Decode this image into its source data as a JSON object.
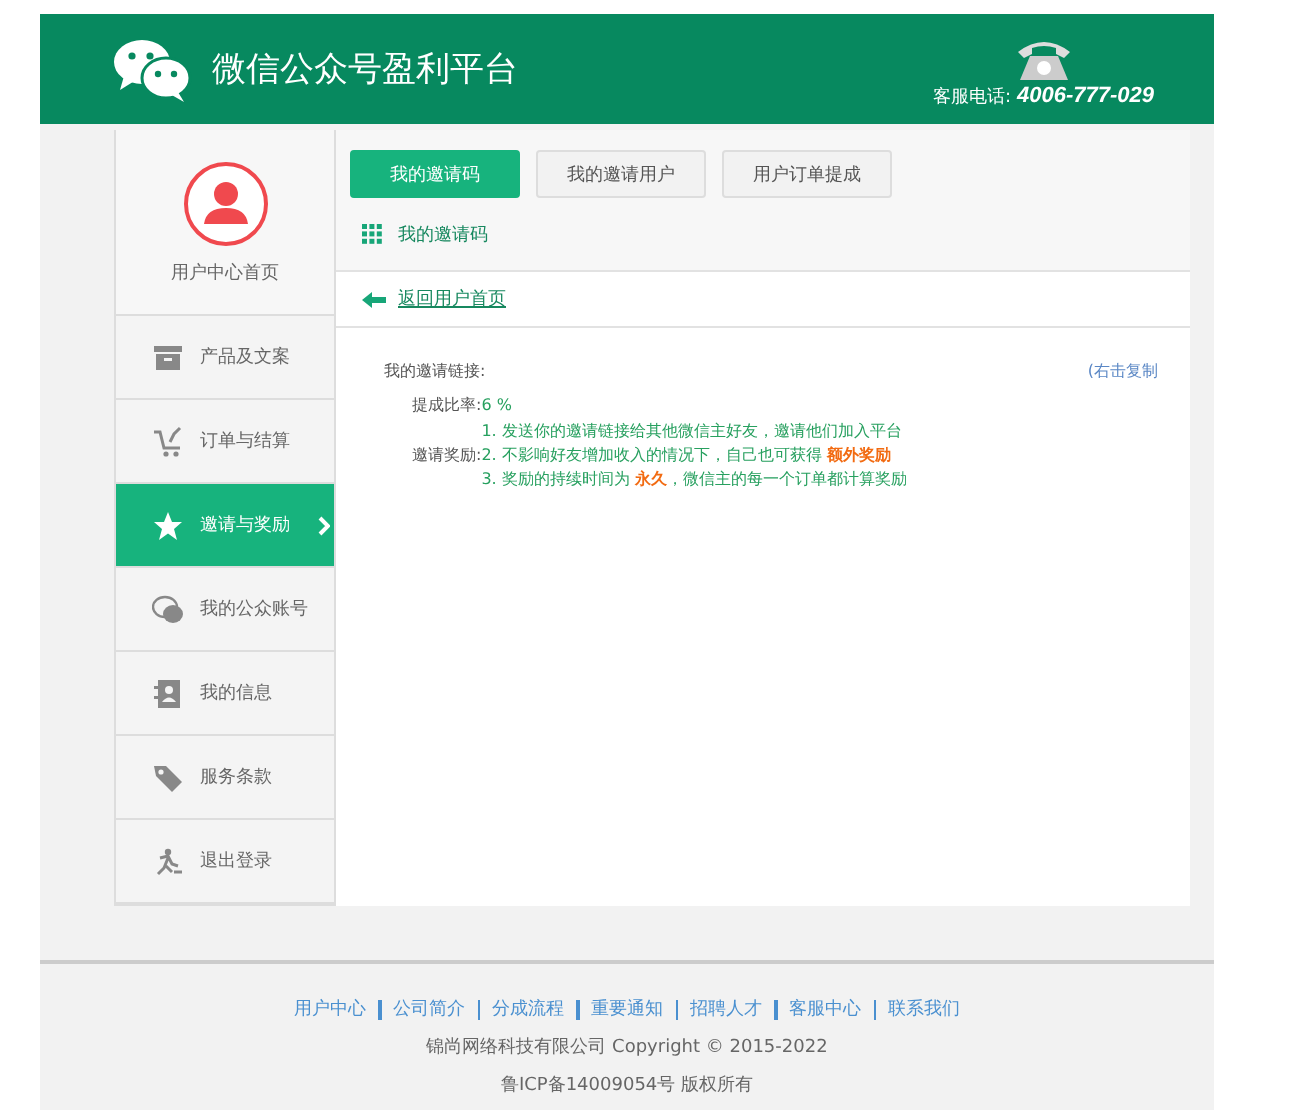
{
  "header": {
    "title": "微信公众号盈利平台",
    "hotline_label": "客服电话:",
    "hotline": "4006-777-029"
  },
  "sidebar": {
    "profile_label": "用户中心首页",
    "items": [
      {
        "label": "产品及文案",
        "selected": false
      },
      {
        "label": "订单与结算",
        "selected": false
      },
      {
        "label": "邀请与奖励",
        "selected": true
      },
      {
        "label": "我的公众账号",
        "selected": false
      },
      {
        "label": "我的信息",
        "selected": false
      },
      {
        "label": "服务条款",
        "selected": false
      },
      {
        "label": "退出登录",
        "selected": false
      }
    ]
  },
  "tabs": [
    {
      "label": "我的邀请码",
      "selected": true
    },
    {
      "label": "我的邀请用户",
      "selected": false
    },
    {
      "label": "用户订单提成",
      "selected": false
    }
  ],
  "section_title": "我的邀请码",
  "back_link": "返回用户首页",
  "invite": {
    "link_label": "我的邀请链接:",
    "copy_hint": "(右击复制",
    "rate_label": "提成比率:",
    "rate": "6 %",
    "reward_label": "邀请奖励:",
    "rewards": [
      "1. 发送你的邀请链接给其他微信主好友，邀请他们加入平台",
      "2. 不影响好友增加收入的情况下，自己也可获得 **额外奖励**",
      "3. 奖励的持续时间为 **永久**，微信主的每一个订单都计算奖励"
    ]
  },
  "footer": {
    "links": [
      "用户中心",
      "公司简介",
      "分成流程",
      "重要通知",
      "招聘人才",
      "客服中心",
      "联系我们"
    ],
    "copyright": "锦尚网络科技有限公司  Copyright © 2015-2022",
    "icp": "鲁ICP备14009054号 版权所有"
  }
}
